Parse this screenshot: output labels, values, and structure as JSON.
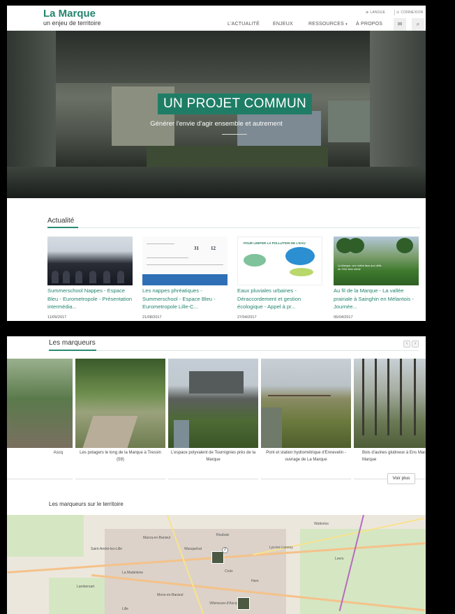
{
  "header": {
    "logo_title": "La Marque",
    "logo_subtitle": "un enjeu de territoire",
    "utility": {
      "langue": "LANGUE",
      "connexion": "CONNEXION"
    },
    "nav": [
      "L'ACTUALITÉ",
      "ENJEUX",
      "RESSOURCES",
      "À PROPOS"
    ]
  },
  "hero": {
    "title": "UN PROJET COMMUN",
    "subtitle": "Générer l'envie d'agir ensemble et autrement"
  },
  "actualite": {
    "heading": "Actualité",
    "items": [
      {
        "title": "Summerschool Nappes - Espace Bleu - Eurometropole - Présentation intermédia...",
        "date": "11/09/2017"
      },
      {
        "title": "Les nappes phréatiques - Summerschool - Espace Bleu - Eurometropole Lille-C...",
        "date": "21/08/2017"
      },
      {
        "title": "Eaux pluviales urbaines - Déraccordement et gestion écologique - Appel à pr...",
        "date": "27/04/2017"
      },
      {
        "title": "Au fil de la Marque - La vallée prairiale à Sainghin en Mélantois - Journée...",
        "date": "06/04/2017"
      }
    ],
    "thumb_texts": {
      "t2_num1": "31",
      "t2_num2": "12",
      "t3_head": "POUR LIMITER LA POLLUTION DE L'EAU",
      "t4_caption": "La Marque, une rivière face aux défis de XXIe âme siècle"
    }
  },
  "marqueurs": {
    "heading": "Les marqueurs",
    "prev": "‹",
    "next": "›",
    "items": [
      {
        "caption": "Ascq"
      },
      {
        "caption": "Les potagers le long de la Marque à Tressin (59)"
      },
      {
        "caption": "L'espace polyvalent de Tournignies près de la Marque"
      },
      {
        "caption": "Pont et station hydrométrique d'Ennevelin - ouvrage de La Marque"
      },
      {
        "caption": "Bois d'aulnes glutineux à Ens Marais de La Marque"
      }
    ],
    "voir_plus": "Voir plus"
  },
  "territoire": {
    "heading": "Les marqueurs sur le territoire",
    "cluster_count": "2",
    "map_labels": [
      "Marcq-en-Barœul",
      "Wasquehal",
      "Croix",
      "Lys-lez-Lannoy",
      "La Madeleine",
      "Lille",
      "Roubaix",
      "Hem",
      "Mons-en-Barœul",
      "Villeneuve-d'Ascq",
      "Wattrelos",
      "Leers",
      "Lambersart",
      "Saint-André-lez-Lille"
    ]
  }
}
